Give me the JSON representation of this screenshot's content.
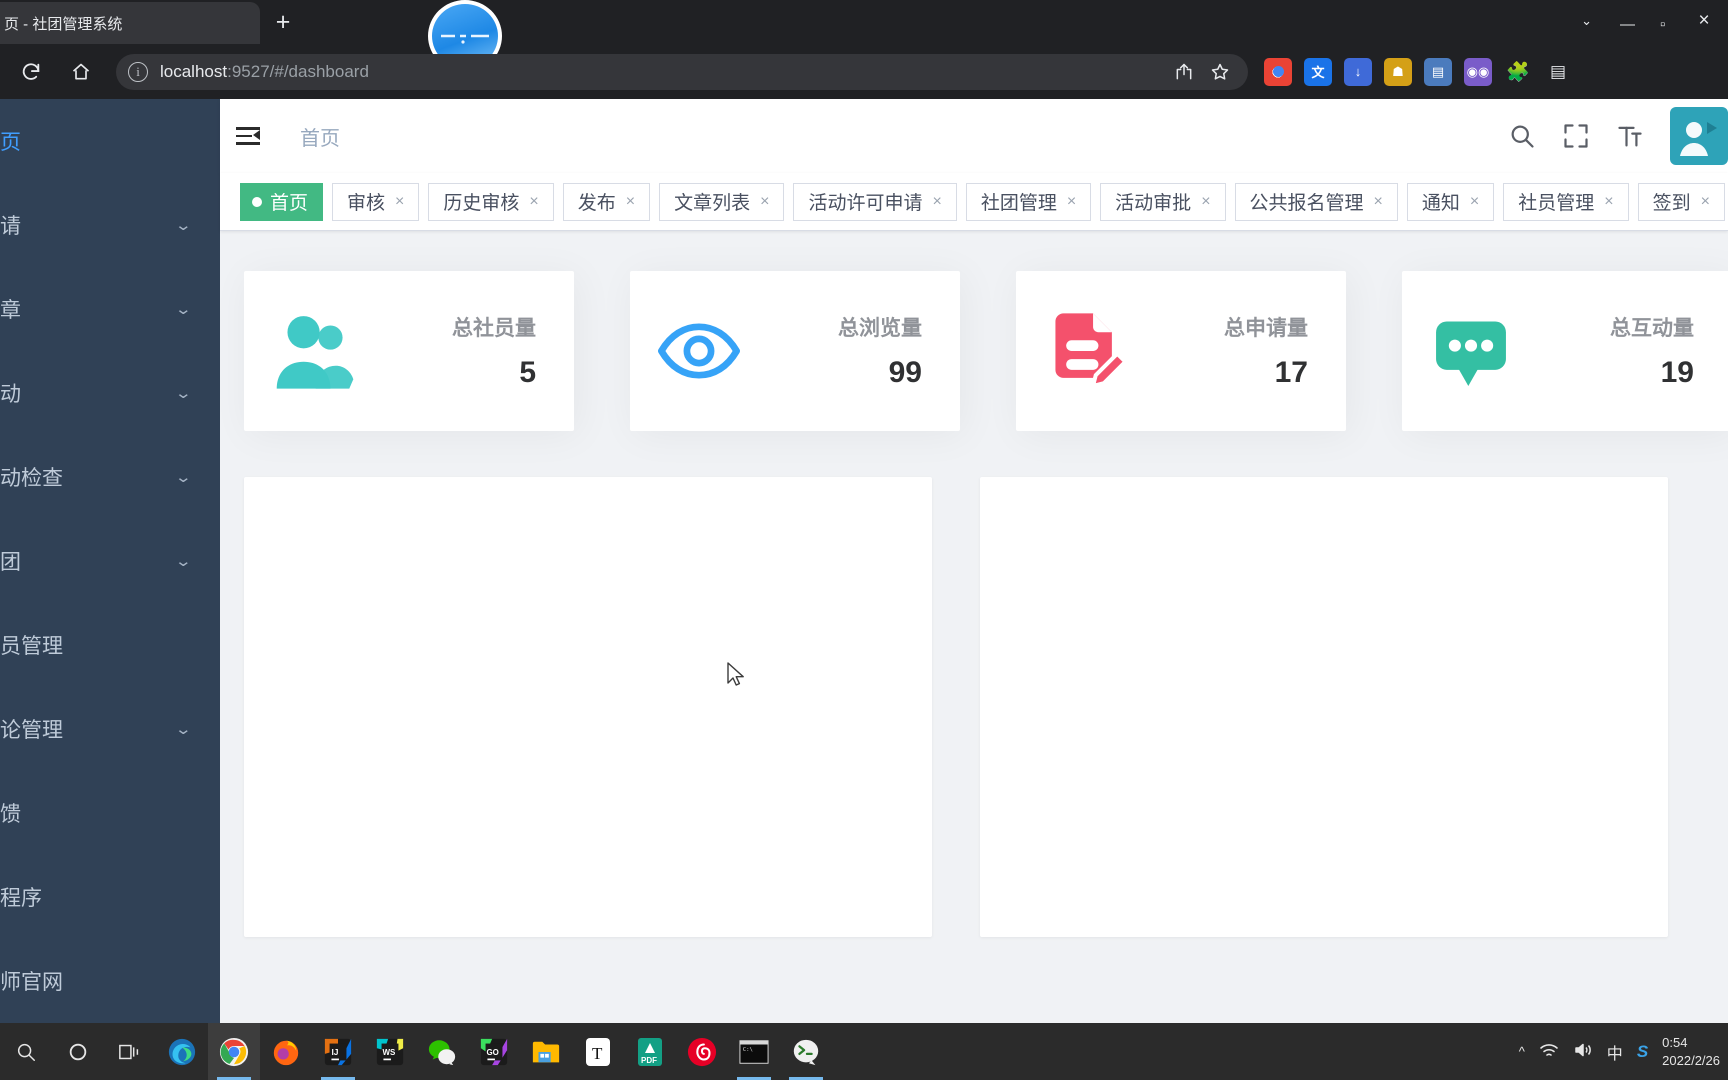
{
  "browser": {
    "tab_title": "页 - 社团管理系统",
    "tab_close_icon": "close-icon",
    "new_tab_icon": "plus-icon",
    "reload_icon": "reload-icon",
    "home_icon": "home-icon",
    "info_icon": "info-icon",
    "url_host": "localhost",
    "url_path": ":9527/#/dashboard",
    "share_icon": "share-icon",
    "bookmark_icon": "star-icon",
    "window_chevron": "chevron-down-icon",
    "window_minimize": "minimize-icon",
    "window_maximize": "maximize-icon",
    "extensions": [
      {
        "name": "chrome-profile-icon",
        "label": "",
        "color": "#f5f5f5"
      },
      {
        "name": "translate-icon",
        "label": "",
        "color": "#1a73e8"
      },
      {
        "name": "download-icon",
        "label": "",
        "color": "#3f6ad8"
      },
      {
        "name": "user-script-icon",
        "label": "",
        "color": "#d4a017"
      },
      {
        "name": "clipboard-icon",
        "label": "",
        "color": "#4b7bbd"
      },
      {
        "name": "adblock-icon",
        "label": "",
        "color": "#7a5cc9"
      },
      {
        "name": "puzzle-icon",
        "label": "",
        "color": "#5f6368"
      },
      {
        "name": "sidepanel-icon",
        "label": "",
        "color": "#5f6368"
      }
    ],
    "camera_overlay": "webcam-bubble"
  },
  "sidebar": {
    "items": [
      {
        "label": "页",
        "name": "sidebar-item-home",
        "active": true,
        "caret": false
      },
      {
        "label": "请",
        "name": "sidebar-item-application",
        "active": false,
        "caret": true
      },
      {
        "label": "章",
        "name": "sidebar-item-article",
        "active": false,
        "caret": true
      },
      {
        "label": "动",
        "name": "sidebar-item-activity",
        "active": false,
        "caret": true
      },
      {
        "label": "动检查",
        "name": "sidebar-item-activity-check",
        "active": false,
        "caret": true
      },
      {
        "label": "团",
        "name": "sidebar-item-club",
        "active": false,
        "caret": true
      },
      {
        "label": "员管理",
        "name": "sidebar-item-member-manage",
        "active": false,
        "caret": false
      },
      {
        "label": "论管理",
        "name": "sidebar-item-comment-manage",
        "active": false,
        "caret": true
      },
      {
        "label": "馈",
        "name": "sidebar-item-feedback",
        "active": false,
        "caret": false
      },
      {
        "label": "程序",
        "name": "sidebar-item-miniprogram",
        "active": false,
        "caret": false
      },
      {
        "label": "师官网",
        "name": "sidebar-item-teacher-site",
        "active": false,
        "caret": false
      }
    ]
  },
  "navbar": {
    "hamburger_icon": "hamburger-collapse-icon",
    "breadcrumb": "首页",
    "search_icon": "search-icon",
    "fullscreen_icon": "fullscreen-icon",
    "font_size_icon": "font-size-icon",
    "avatar_icon": "avatar"
  },
  "tags_view": {
    "tags": [
      {
        "label": "首页",
        "active": true,
        "closable": false
      },
      {
        "label": "审核",
        "active": false,
        "closable": true
      },
      {
        "label": "历史审核",
        "active": false,
        "closable": true
      },
      {
        "label": "发布",
        "active": false,
        "closable": true
      },
      {
        "label": "文章列表",
        "active": false,
        "closable": true
      },
      {
        "label": "活动许可申请",
        "active": false,
        "closable": true
      },
      {
        "label": "社团管理",
        "active": false,
        "closable": true
      },
      {
        "label": "活动审批",
        "active": false,
        "closable": true
      },
      {
        "label": "公共报名管理",
        "active": false,
        "closable": true
      },
      {
        "label": "通知",
        "active": false,
        "closable": true
      },
      {
        "label": "社员管理",
        "active": false,
        "closable": true
      },
      {
        "label": "签到",
        "active": false,
        "closable": true
      }
    ],
    "close_icon": "close-icon",
    "active_color": "#42b983"
  },
  "panels": [
    {
      "label": "总社员量",
      "value": "5",
      "icon": "peoples-icon",
      "color": "#40c9c6"
    },
    {
      "label": "总浏览量",
      "value": "99",
      "icon": "eye-icon",
      "color": "#36a3f7"
    },
    {
      "label": "总申请量",
      "value": "17",
      "icon": "document-edit-icon",
      "color": "#f4516c"
    },
    {
      "label": "总互动量",
      "value": "19",
      "icon": "message-icon",
      "color": "#34bfa3"
    }
  ],
  "charts": [
    {
      "name": "chart-panel-left",
      "content": ""
    },
    {
      "name": "chart-panel-right",
      "content": ""
    }
  ],
  "taskbar": {
    "system_icons": [
      {
        "name": "taskbar-search-icon",
        "glyph": "search"
      },
      {
        "name": "taskbar-cortana-icon",
        "glyph": "circle"
      },
      {
        "name": "taskbar-taskview-icon",
        "glyph": "taskview"
      }
    ],
    "apps": [
      {
        "name": "taskbar-edge",
        "label": "e",
        "color": "#1b73b8",
        "state": ""
      },
      {
        "name": "taskbar-chrome",
        "label": "",
        "color": "#ffffff",
        "state": "active"
      },
      {
        "name": "taskbar-firefox",
        "label": "",
        "color": "#ff6611",
        "state": ""
      },
      {
        "name": "taskbar-intellij",
        "label": "IJ",
        "color": "#1b1b1b",
        "state": "running"
      },
      {
        "name": "taskbar-webstorm",
        "label": "WS",
        "color": "#1b1b1b",
        "state": ""
      },
      {
        "name": "taskbar-wechat",
        "label": "",
        "color": "#2dc100",
        "state": ""
      },
      {
        "name": "taskbar-goland",
        "label": "GO",
        "color": "#1b1b1b",
        "state": ""
      },
      {
        "name": "taskbar-explorer",
        "label": "",
        "color": "#ffb900",
        "state": ""
      },
      {
        "name": "taskbar-typora",
        "label": "T",
        "color": "#ffffff",
        "state": ""
      },
      {
        "name": "taskbar-pdf",
        "label": "PDF",
        "color": "#13a085",
        "state": ""
      },
      {
        "name": "taskbar-netease",
        "label": "",
        "color": "#e60026",
        "state": ""
      },
      {
        "name": "taskbar-cmd",
        "label": "",
        "color": "#0c0c0c",
        "state": "running"
      },
      {
        "name": "taskbar-terminal",
        "label": ">_",
        "color": "#f0f0f0",
        "state": "running"
      }
    ],
    "tray": {
      "chevron": "^",
      "network_icon": "wifi-icon",
      "volume_icon": "volume-icon",
      "ime": "中",
      "sogou_icon": "S"
    },
    "clock_time": "0:54",
    "clock_date": "2022/2/26"
  }
}
